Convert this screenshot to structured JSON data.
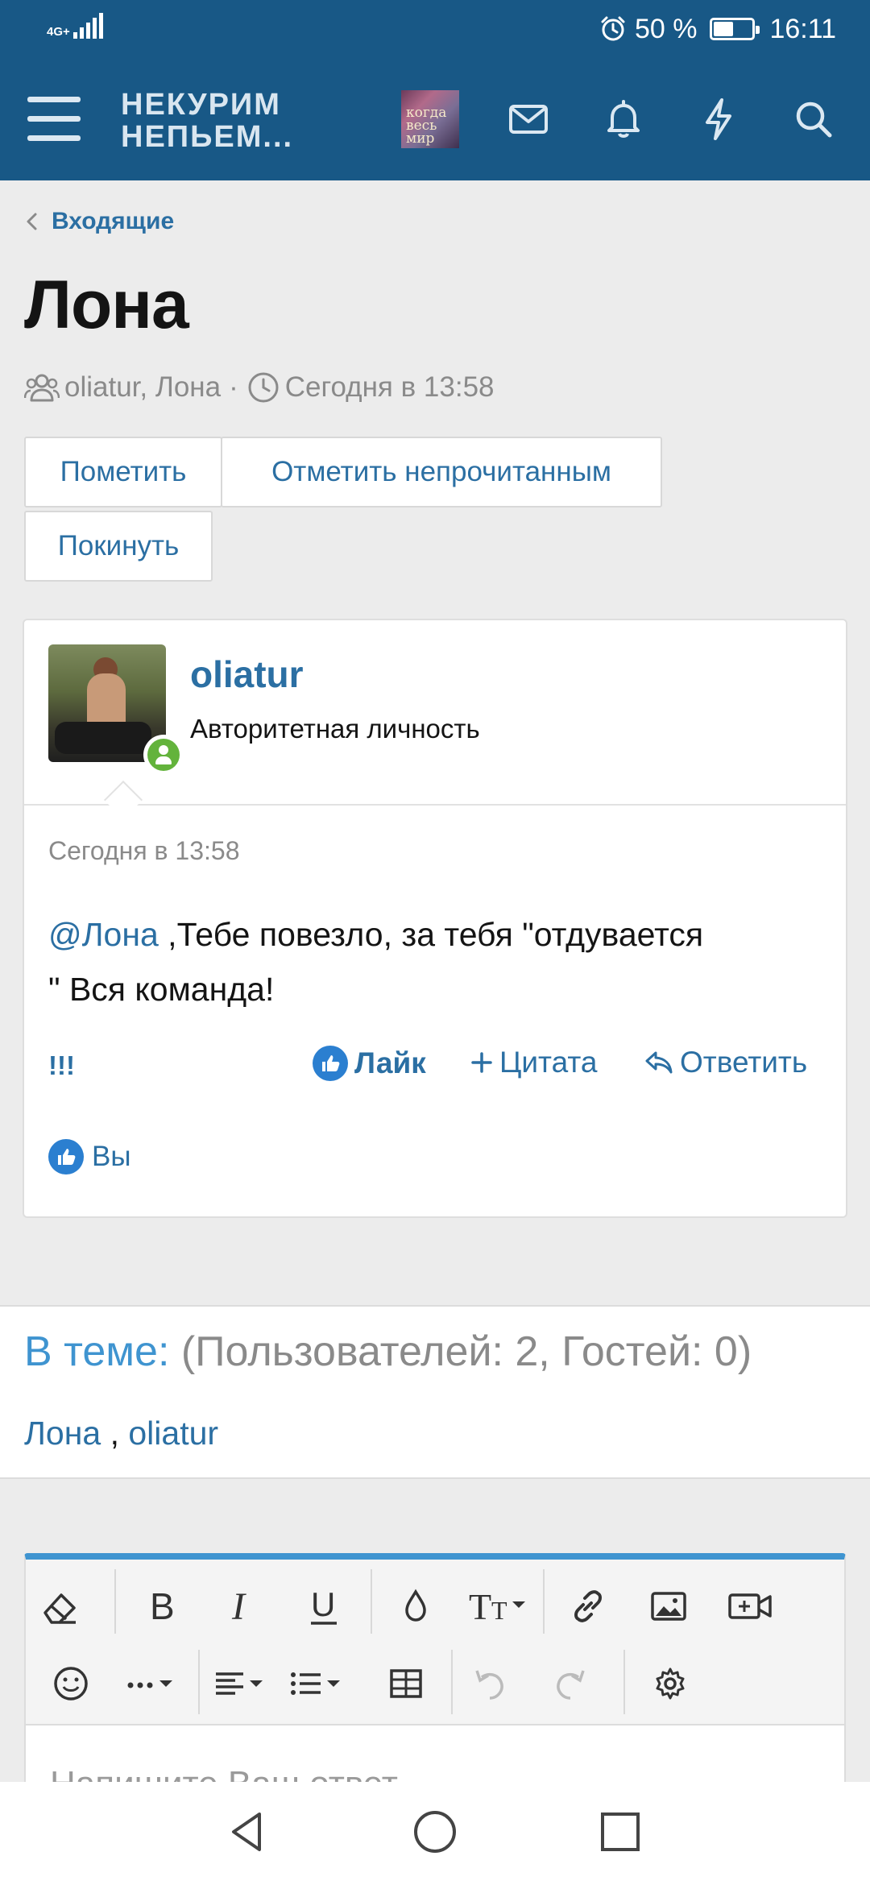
{
  "status_bar": {
    "network": "4G+",
    "battery": "50 %",
    "battery_level": 0.5,
    "time": "16:11",
    "alarm_icon": "alarm-icon"
  },
  "header": {
    "logo_line1": "НЕКУРИМ",
    "logo_line2": "НЕПЬЕМ...",
    "avatar_caption": "когда весь мир",
    "icons": [
      "menu-icon",
      "mail-icon",
      "bell-icon",
      "bolt-icon",
      "search-icon"
    ]
  },
  "breadcrumb": {
    "label": "Входящие"
  },
  "conversation": {
    "title": "Лона",
    "participants": "oliatur, Лона",
    "separator": "·",
    "date": "Сегодня в 13:58"
  },
  "buttons": {
    "mark": "Пометить",
    "mark_unread": "Отметить непрочитанным",
    "leave": "Покинуть"
  },
  "message": {
    "author": "oliatur",
    "author_title": "Авторитетная личность",
    "date": "Сегодня в 13:58",
    "mention": "@Лона",
    "text_line1": " ,Тебе повезло, за тебя \"отдувается",
    "text_line2": "\" Вся команда!",
    "report_label": "!!!",
    "like_label": "Лайк",
    "quote_label": "Цитата",
    "reply_label": "Ответить",
    "reactions_label": "Вы"
  },
  "whos_here": {
    "label": "В теме:",
    "counts": "(Пользователей: 2, Гостей: 0)",
    "user1": "Лона",
    "separator": ",",
    "user2": "oliatur"
  },
  "editor": {
    "placeholder": "Напишите Ваш ответ...",
    "toolbar": [
      "eraser-icon",
      "bold-icon",
      "italic-icon",
      "underline-icon",
      "color-icon",
      "font-size-icon",
      "link-icon",
      "image-icon",
      "video-icon",
      "smiley-icon",
      "more-icon",
      "align-icon",
      "list-icon",
      "table-icon",
      "undo-icon",
      "redo-icon",
      "settings-icon"
    ]
  },
  "colors": {
    "header_bg": "#185886",
    "link": "#2b6fa3",
    "accent": "#3f94d0",
    "online": "#63b33c",
    "page_bg": "#ececec"
  }
}
